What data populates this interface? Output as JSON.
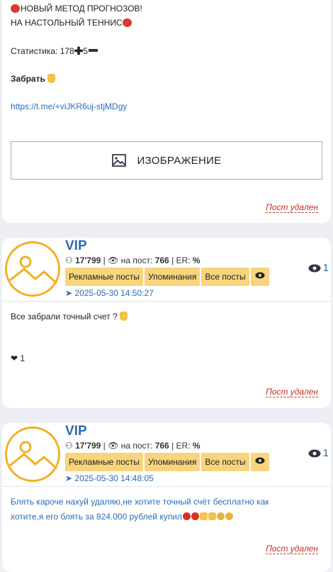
{
  "post1": {
    "line1": "НОВЫЙ МЕТОД ПРОГНОЗОВ!",
    "line2": "НА НАСТОЛЬНЫЙ ТЕННИС",
    "stats_label": "Статистика: 178",
    "stats_minus_value": "5",
    "grab_label": "Забрать",
    "link": "https://t.me/+viJKR6uj-stjMDgy",
    "image_label": "ИЗОБРАЖЕНИЕ",
    "deleted_label": "Пост удален"
  },
  "posts": [
    {
      "channel_title": "VIP",
      "subscribers": "17'799",
      "per_post_label": "на пост:",
      "per_post": "766",
      "er_label": "ER:",
      "er_value": "%",
      "tags": [
        "Рекламные посты",
        "Упоминания",
        "Все посты"
      ],
      "date": "2025-05-30 14:50:27",
      "views": "1",
      "text": "Все забрали точный счет ?",
      "likes": "1",
      "deleted_label": "Пост удален"
    },
    {
      "channel_title": "VIP",
      "subscribers": "17'799",
      "per_post_label": "на пост:",
      "per_post": "766",
      "er_label": "ER:",
      "er_value": "%",
      "tags": [
        "Рекламные посты",
        "Упоминания",
        "Все посты"
      ],
      "date": "2025-05-30 14:48:05",
      "views": "1",
      "text_line1": "Блять кароче нахуй удаляю,не хотите точный счёт бесплатно как",
      "text_line2": "хотите,я его блять за 824.000 рублей купил",
      "deleted_label": "Пост удален"
    }
  ],
  "colors": {
    "accent": "#2c6bb0",
    "tag": "#f8d57c",
    "deleted": "#c5302a",
    "avatar": "#f2b022"
  }
}
